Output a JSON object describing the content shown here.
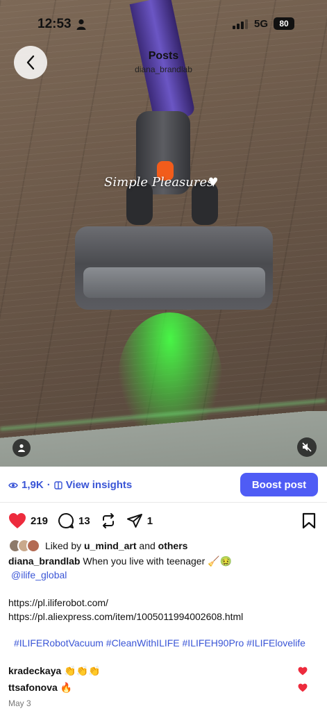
{
  "status_bar": {
    "time": "12:53",
    "network": "5G",
    "battery": "80"
  },
  "header": {
    "title": "Posts",
    "username": "diana_brandlab"
  },
  "media": {
    "overlay_text": "Simple Pleasures"
  },
  "insights": {
    "views": "1,9K",
    "separator": "·",
    "view_insights_label": "View insights",
    "boost_label": "Boost post"
  },
  "actions": {
    "likes": "219",
    "comments": "13",
    "shares": "1"
  },
  "liked_by": {
    "prefix": "Liked by ",
    "user": "u_mind_art",
    "middle": " and ",
    "suffix": "others"
  },
  "caption": {
    "author": "diana_brandlab",
    "text": " When you live with teenager 🧹🤢",
    "mention": "@ilife_global",
    "link1": "https://pl.iliferobot.com/",
    "link2": "https://pl.aliexpress.com/item/1005011994002608.html",
    "hashtags": "#ILIFERobotVacuum #CleanWithILIFE #ILIFEH90Pro #ILIFElovelife"
  },
  "comments": [
    {
      "user": "kradeckaya",
      "text": "👏👏👏"
    },
    {
      "user": "ttsafonova",
      "text": "🔥"
    }
  ],
  "date": "May 3",
  "colors": {
    "accent": "#4f5cf5",
    "link": "#3a55d6",
    "like_red": "#ed2b3d"
  }
}
